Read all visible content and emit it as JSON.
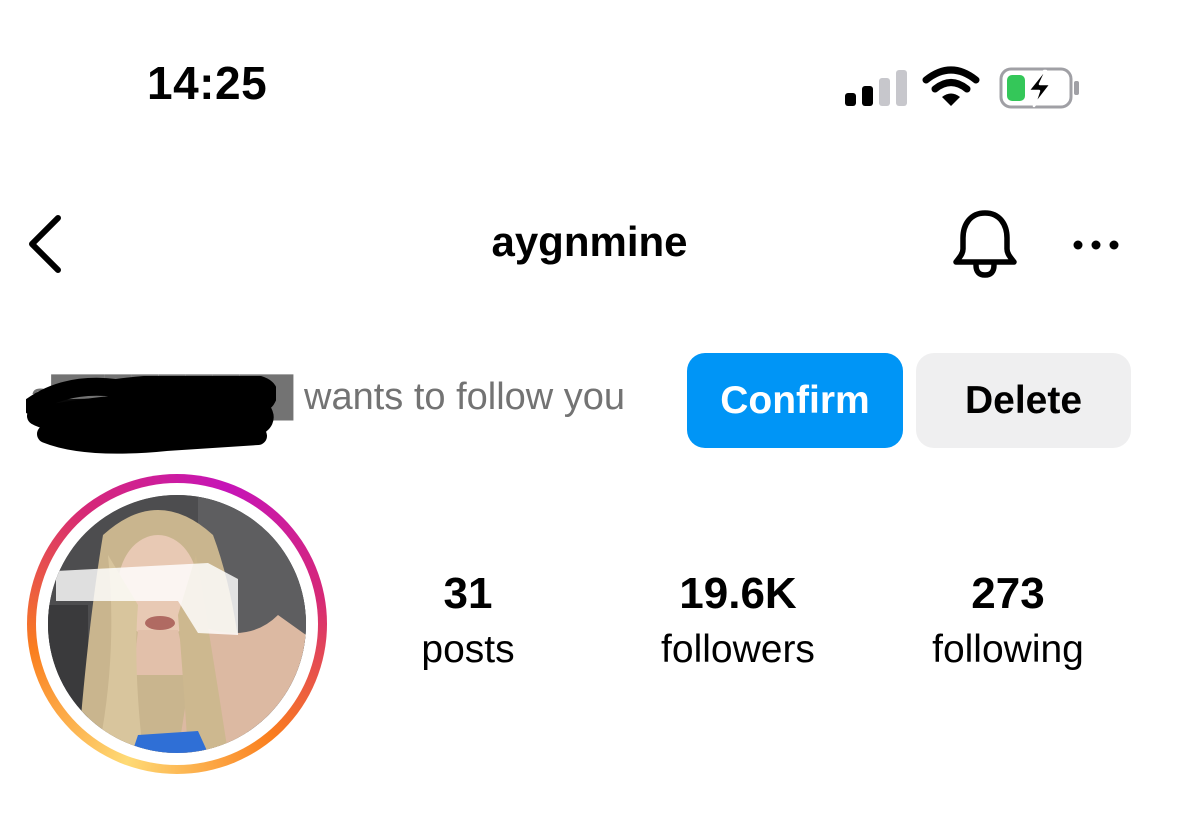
{
  "status_bar": {
    "time": "14:25",
    "signal_icon": "cellular-signal-icon",
    "wifi_icon": "wifi-icon",
    "battery_icon": "battery-charging-icon",
    "battery_color": "#34c759"
  },
  "header": {
    "back_icon": "chevron-left-icon",
    "username": "aygnmine",
    "bell_icon": "bell-icon",
    "more_icon": "more-horizontal-icon"
  },
  "follow_request": {
    "text": "a█████████ wants to follow you",
    "confirm_label": "Confirm",
    "delete_label": "Delete",
    "confirm_color": "#0095f6"
  },
  "profile": {
    "avatar": "profile-photo",
    "stats": [
      {
        "value": "31",
        "label": "posts"
      },
      {
        "value": "19.6K",
        "label": "followers"
      },
      {
        "value": "273",
        "label": "following"
      }
    ]
  }
}
